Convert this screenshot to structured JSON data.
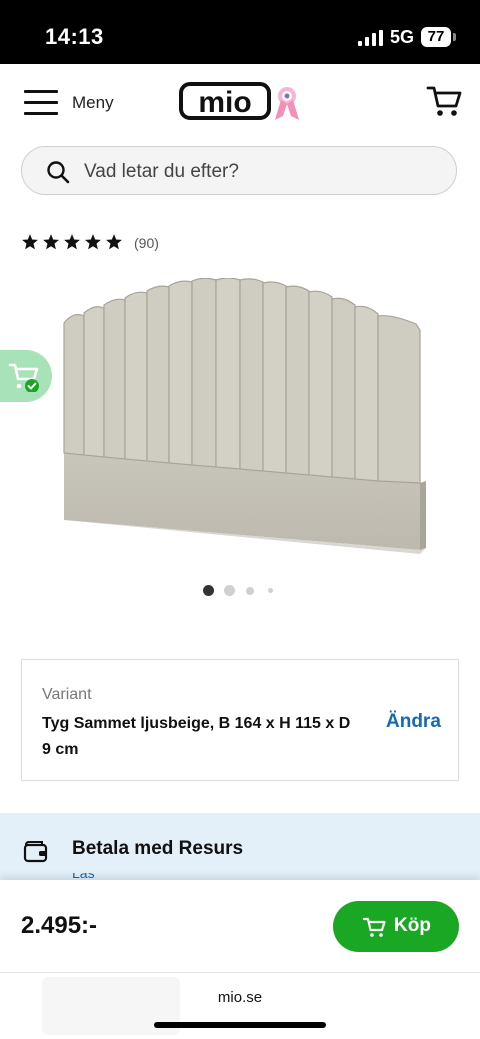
{
  "status": {
    "time": "14:13",
    "network": "5G",
    "battery": "77"
  },
  "header": {
    "menu_label": "Meny",
    "logo_text": "mio"
  },
  "search": {
    "placeholder": "Vad letar du efter?"
  },
  "product": {
    "rating": 5,
    "review_count": "(90)",
    "image_count": 4,
    "active_image": 1
  },
  "variant": {
    "label": "Variant",
    "value": "Tyg Sammet ljusbeige, B 164 x H 115 x D 9 cm",
    "change_label": "Ändra"
  },
  "payment": {
    "title": "Betala med Resurs",
    "more_label": "Läs mer"
  },
  "buybar": {
    "price": "2.495:-",
    "buy_label": "Köp"
  },
  "browser": {
    "url": "mio.se"
  },
  "colors": {
    "accent_green": "#1aa724",
    "link_blue": "#1769b3",
    "payment_bg": "#e3eff9",
    "fab_green": "#a8e2b8"
  }
}
